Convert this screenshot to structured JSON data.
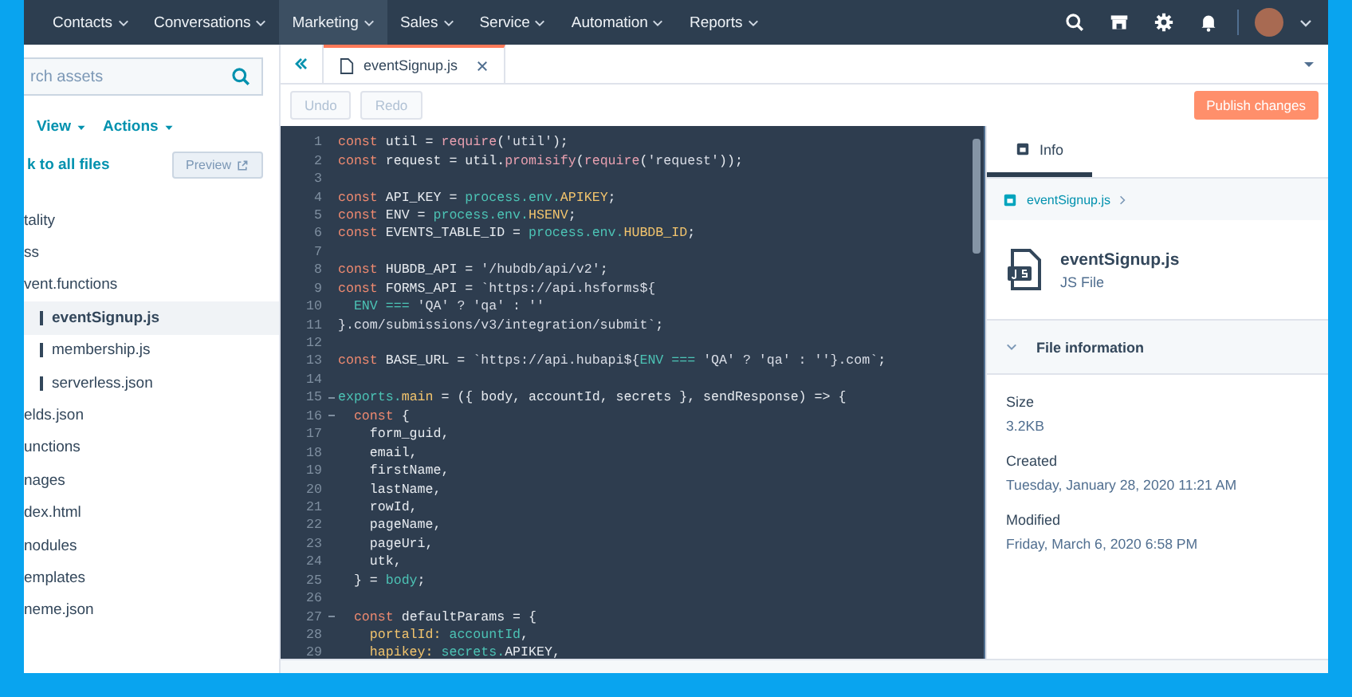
{
  "nav": {
    "items": [
      {
        "label": "Contacts",
        "selected": false
      },
      {
        "label": "Conversations",
        "selected": false
      },
      {
        "label": "Marketing",
        "selected": true
      },
      {
        "label": "Sales",
        "selected": false
      },
      {
        "label": "Service",
        "selected": false
      },
      {
        "label": "Automation",
        "selected": false
      },
      {
        "label": "Reports",
        "selected": false
      }
    ]
  },
  "sidebar": {
    "search": {
      "placeholder": "rch assets"
    },
    "menus": [
      "View",
      "Actions"
    ],
    "back_link": "k to all files",
    "preview_button": "Preview",
    "tree": [
      {
        "label": "tality",
        "selected": false
      },
      {
        "label": "ss",
        "selected": false
      },
      {
        "label": "vent.functions",
        "selected": false,
        "children": [
          {
            "label": "eventSignup.js",
            "selected": true
          },
          {
            "label": "membership.js",
            "selected": false
          },
          {
            "label": "serverless.json",
            "selected": false
          }
        ]
      },
      {
        "label": "elds.json",
        "selected": false
      },
      {
        "label": "unctions",
        "selected": false
      },
      {
        "label": "nages",
        "selected": false
      },
      {
        "label": "dex.html",
        "selected": false
      },
      {
        "label": "nodules",
        "selected": false
      },
      {
        "label": "emplates",
        "selected": false
      },
      {
        "label": "neme.json",
        "selected": false
      }
    ]
  },
  "editor": {
    "tab": {
      "label": "eventSignup.js"
    },
    "toolbar": [
      {
        "label": "Undo",
        "disabled": true
      },
      {
        "label": "Redo",
        "disabled": true
      }
    ],
    "publish_button": "Publish changes",
    "lines": [
      {
        "n": "1",
        "fold": false,
        "tokens": [
          {
            "kind": "kw",
            "text": "const "
          },
          {
            "kind": "plain",
            "text": "util = "
          },
          {
            "kind": "fn",
            "text": "require"
          },
          {
            "kind": "plain",
            "text": "("
          },
          {
            "kind": "str",
            "text": "'util'"
          },
          {
            "kind": "plain",
            "text": ");"
          }
        ]
      },
      {
        "n": "2",
        "fold": false,
        "tokens": [
          {
            "kind": "kw",
            "text": "const "
          },
          {
            "kind": "plain",
            "text": "request = util."
          },
          {
            "kind": "fn",
            "text": "promisify"
          },
          {
            "kind": "plain",
            "text": "("
          },
          {
            "kind": "fn",
            "text": "require"
          },
          {
            "kind": "plain",
            "text": "("
          },
          {
            "kind": "str",
            "text": "'request'"
          },
          {
            "kind": "plain",
            "text": "));"
          }
        ]
      },
      {
        "n": "3",
        "fold": false
      },
      {
        "n": "4",
        "fold": false,
        "tokens": [
          {
            "kind": "kw",
            "text": "const "
          },
          {
            "kind": "plain",
            "text": "API_KEY = "
          },
          {
            "kind": "var",
            "text": "process.env."
          },
          {
            "kind": "prop",
            "text": "APIKEY"
          },
          {
            "kind": "plain",
            "text": ";"
          }
        ]
      },
      {
        "n": "5",
        "fold": false,
        "tokens": [
          {
            "kind": "kw",
            "text": "const "
          },
          {
            "kind": "plain",
            "text": "ENV = "
          },
          {
            "kind": "var",
            "text": "process.env."
          },
          {
            "kind": "prop",
            "text": "HSENV"
          },
          {
            "kind": "plain",
            "text": ";"
          }
        ]
      },
      {
        "n": "6",
        "fold": false,
        "tokens": [
          {
            "kind": "kw",
            "text": "const "
          },
          {
            "kind": "plain",
            "text": "EVENTS_TABLE_ID = "
          },
          {
            "kind": "var",
            "text": "process.env."
          },
          {
            "kind": "prop",
            "text": "HUBDB_ID"
          },
          {
            "kind": "plain",
            "text": ";"
          }
        ]
      },
      {
        "n": "7",
        "fold": false
      },
      {
        "n": "8",
        "fold": false,
        "tokens": [
          {
            "kind": "kw",
            "text": "const "
          },
          {
            "kind": "plain",
            "text": "HUBDB_API = "
          },
          {
            "kind": "str",
            "text": "'/hubdb/api/v2'"
          },
          {
            "kind": "plain",
            "text": ";"
          }
        ]
      },
      {
        "n": "9",
        "fold": false,
        "tokens": [
          {
            "kind": "kw",
            "text": "const "
          },
          {
            "kind": "plain",
            "text": "FORMS_API = "
          },
          {
            "kind": "str",
            "text": "`https://api.hsforms${"
          }
        ]
      },
      {
        "n": "10",
        "fold": false,
        "tokens": [
          {
            "kind": "var",
            "text": "  ENV === "
          },
          {
            "kind": "str",
            "text": "'QA' ? 'qa' : ''"
          }
        ]
      },
      {
        "n": "11",
        "fold": false,
        "tokens": [
          {
            "kind": "str",
            "text": "}.com/submissions/v3/integration/submit`"
          },
          {
            "kind": "plain",
            "text": ";"
          }
        ]
      },
      {
        "n": "12",
        "fold": false
      },
      {
        "n": "13",
        "fold": false,
        "tokens": [
          {
            "kind": "kw",
            "text": "const "
          },
          {
            "kind": "plain",
            "text": "BASE_URL = "
          },
          {
            "kind": "str",
            "text": "`https://api.hubapi${"
          },
          {
            "kind": "var",
            "text": "ENV === "
          },
          {
            "kind": "str",
            "text": "'QA' ? 'qa' : ''}.com`"
          },
          {
            "kind": "plain",
            "text": ";"
          }
        ]
      },
      {
        "n": "14",
        "fold": false
      },
      {
        "n": "15",
        "fold": true,
        "tokens": [
          {
            "kind": "var",
            "text": "exports."
          },
          {
            "kind": "prop",
            "text": "main"
          },
          {
            "kind": "plain",
            "text": " = ({ body, accountId, secrets }, sendResponse) => {"
          }
        ]
      },
      {
        "n": "16",
        "fold": true,
        "tokens": [
          {
            "kind": "kw",
            "text": "  const "
          },
          {
            "kind": "plain",
            "text": "{"
          }
        ]
      },
      {
        "n": "17",
        "fold": false,
        "tokens": [
          {
            "kind": "plain",
            "text": "    form_guid,"
          }
        ]
      },
      {
        "n": "18",
        "fold": false,
        "tokens": [
          {
            "kind": "plain",
            "text": "    email,"
          }
        ]
      },
      {
        "n": "19",
        "fold": false,
        "tokens": [
          {
            "kind": "plain",
            "text": "    firstName,"
          }
        ]
      },
      {
        "n": "20",
        "fold": false,
        "tokens": [
          {
            "kind": "plain",
            "text": "    lastName,"
          }
        ]
      },
      {
        "n": "21",
        "fold": false,
        "tokens": [
          {
            "kind": "plain",
            "text": "    rowId,"
          }
        ]
      },
      {
        "n": "22",
        "fold": false,
        "tokens": [
          {
            "kind": "plain",
            "text": "    pageName,"
          }
        ]
      },
      {
        "n": "23",
        "fold": false,
        "tokens": [
          {
            "kind": "plain",
            "text": "    pageUri,"
          }
        ]
      },
      {
        "n": "24",
        "fold": false,
        "tokens": [
          {
            "kind": "plain",
            "text": "    utk,"
          }
        ]
      },
      {
        "n": "25",
        "fold": false,
        "tokens": [
          {
            "kind": "plain",
            "text": "  } = "
          },
          {
            "kind": "var",
            "text": "body"
          },
          {
            "kind": "plain",
            "text": ";"
          }
        ]
      },
      {
        "n": "26",
        "fold": false
      },
      {
        "n": "27",
        "fold": true,
        "tokens": [
          {
            "kind": "kw",
            "text": "  const "
          },
          {
            "kind": "plain",
            "text": "defaultParams = {"
          }
        ]
      },
      {
        "n": "28",
        "fold": false,
        "tokens": [
          {
            "kind": "prop",
            "text": "    portalId: "
          },
          {
            "kind": "var",
            "text": "accountId"
          },
          {
            "kind": "plain",
            "text": ","
          }
        ]
      },
      {
        "n": "29",
        "fold": false,
        "tokens": [
          {
            "kind": "prop",
            "text": "    hapikey: "
          },
          {
            "kind": "var",
            "text": "secrets."
          },
          {
            "kind": "plain",
            "text": "APIKEY,"
          }
        ]
      }
    ]
  },
  "info_panel": {
    "tabs": [
      {
        "label": "Info",
        "selected": true
      }
    ],
    "breadcrumb": "eventSignup.js",
    "file": {
      "name": "eventSignup.js",
      "type": "JS File"
    },
    "section": {
      "title": "File information",
      "expanded": true
    },
    "fields": [
      {
        "label": "Size",
        "value": "3.2KB"
      },
      {
        "label": "Created",
        "value": "Tuesday, January 28, 2020 11:21 AM"
      },
      {
        "label": "Modified",
        "value": "Friday, March 6, 2020 6:58 PM"
      }
    ]
  }
}
